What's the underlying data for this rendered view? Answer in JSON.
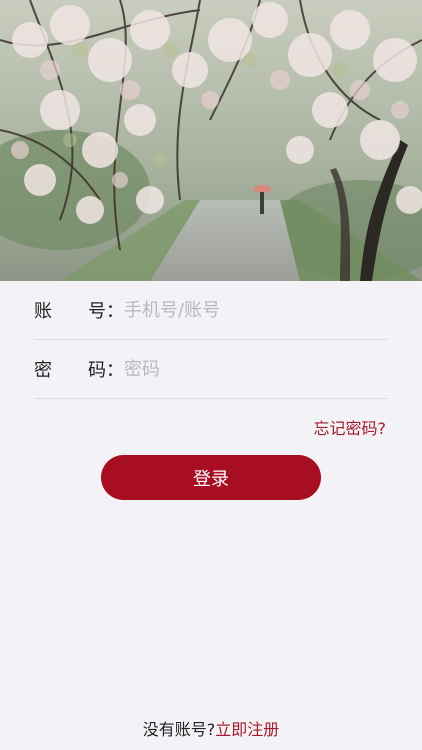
{
  "login": {
    "account_label_a": "账",
    "account_label_b": "号：",
    "account_placeholder": "手机号/账号",
    "account_value": "",
    "password_label_a": "密",
    "password_label_b": "码：",
    "password_placeholder": "密码",
    "password_value": "",
    "forgot_label": "忘记密码?",
    "login_button": "登录"
  },
  "footer": {
    "prompt": "没有账号?",
    "register_link": "立即注册"
  },
  "colors": {
    "accent": "#a80e22",
    "link": "#a61b2b",
    "background": "#f3f3f7"
  }
}
